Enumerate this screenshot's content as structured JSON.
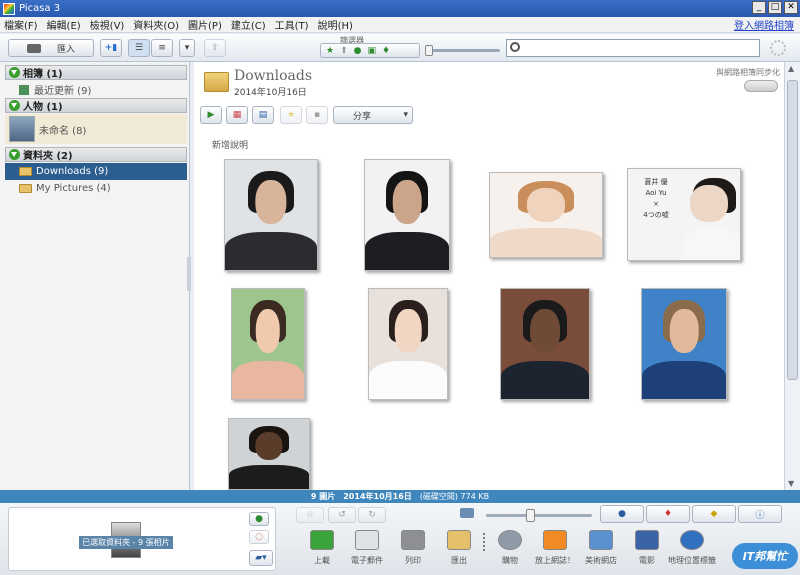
{
  "window": {
    "title": "Picasa 3",
    "minimize": "_",
    "maximize": "□",
    "close": "✕"
  },
  "menu": {
    "items": [
      "檔案(F)",
      "編輯(E)",
      "檢視(V)",
      "資料夾(O)",
      "圖片(P)",
      "建立(C)",
      "工具(T)",
      "說明(H)"
    ],
    "signin": "登入網路相簿"
  },
  "toolbar": {
    "import_label": "匯入",
    "filter_label": "篩選器"
  },
  "sidebar": {
    "albums": {
      "title": "相簿 (1)",
      "items": [
        {
          "label": "最近更新 (9)"
        }
      ]
    },
    "people": {
      "title": "人物 (1)",
      "items": [
        {
          "label": "未命名 (8)"
        }
      ]
    },
    "folders": {
      "title": "資料夾 (2)",
      "items": [
        {
          "label": "Downloads (9)",
          "selected": true
        },
        {
          "label": "My Pictures (4)",
          "selected": false
        }
      ]
    }
  },
  "main": {
    "folder_title": "Downloads",
    "folder_date": "2014年10月16日",
    "sync_label": "與網路相簿同步化",
    "share_label": "分享",
    "caption_placeholder": "新增說明"
  },
  "photos": [
    {
      "desc": "man in dark suit",
      "bg": "#dfe3e6",
      "hair": "#1a1a1a",
      "skin": "#d8b49a",
      "body": "#2b2b30"
    },
    {
      "desc": "young man dark shirt",
      "bg": "#f2f2f2",
      "hair": "#141414",
      "skin": "#caa58a",
      "body": "#1e1e22"
    },
    {
      "desc": "woman light hair",
      "bg": "#f6f1ec",
      "hair": "#c98e5c",
      "skin": "#f0d3bd",
      "body": "#efd9c8"
    },
    {
      "desc": "poster Aoi Yu",
      "bg": "#f4f4f4",
      "hair": "#1d1a18",
      "skin": "#ecd7c6",
      "body": "#f7f7f7",
      "text": [
        "蒼井 優",
        "Aoi Yu",
        "×",
        "4つの嘘"
      ]
    },
    {
      "desc": "woman in hat",
      "bg": "#9fc58f",
      "hair": "#3a2a22",
      "skin": "#f1c9ad",
      "body": "#e9b7a0"
    },
    {
      "desc": "woman white dress",
      "bg": "#e8e0da",
      "hair": "#2a1f1c",
      "skin": "#f2d6c4",
      "body": "#fbfbfb"
    },
    {
      "desc": "man in suit with flag",
      "bg": "#7a4d3a",
      "hair": "#1a1a1a",
      "skin": "#6f4a36",
      "body": "#1c2430"
    },
    {
      "desc": "young man striped shirt",
      "bg": "#3f82c8",
      "hair": "#8a6b4a",
      "skin": "#e2b99a",
      "body": "#1d3f7a"
    },
    {
      "desc": "man close-up",
      "bg": "#cfd3d5",
      "hair": "#1a1411",
      "skin": "#5a3c2b",
      "body": "#1c1c1c"
    }
  ],
  "status": {
    "count": "9 圖片",
    "date": "2014年10月16日",
    "disk": "(磁碟空間) 774 KB"
  },
  "bottom": {
    "tray_label": "已選取資料夾 - 9 張相片",
    "actions": [
      "上載",
      "電子郵件",
      "列印",
      "匯出",
      "購物",
      "放上網誌！",
      "美術網店",
      "電影",
      "地理位置標籤"
    ]
  },
  "watermark": "IT邦幫忙"
}
